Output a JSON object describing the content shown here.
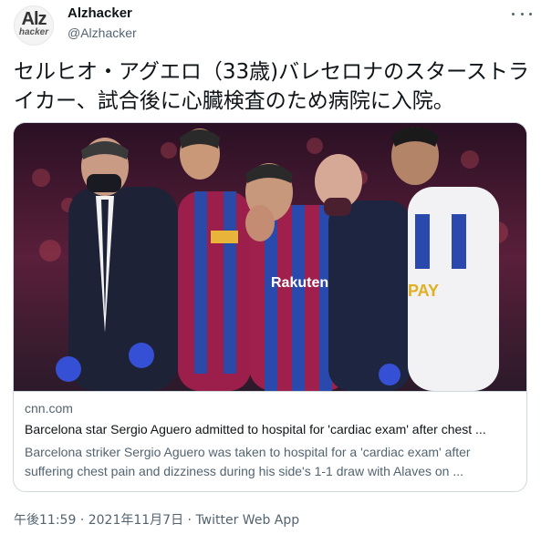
{
  "account": {
    "display_name": "Alzhacker",
    "handle": "@Alzhacker",
    "avatar_text_top": "Alz",
    "avatar_text_bottom": "hacker"
  },
  "tweet": {
    "text": "セルヒオ・アグエロ（33歳)バレセロナのスターストライカー、試合後に心臓検査のため病院に入院。"
  },
  "card": {
    "domain": "cnn.com",
    "title": "Barcelona star Sergio Aguero admitted to hospital for 'cardiac exam' after chest ...",
    "description": "Barcelona striker Sergio Aguero was taken to hospital for a 'cardiac exam' after suffering chest pain and dizziness during his side's 1-1 draw with Alaves on ...",
    "image_labels": {
      "shirt_sponsor": "Rakuten",
      "opponent_sponsor": "PAY"
    }
  },
  "footer": {
    "time": "午後11:59",
    "separator": "·",
    "date": "2021年11月7日",
    "source": "Twitter Web App"
  },
  "colors": {
    "text_primary": "#0f1419",
    "text_secondary": "#536471",
    "border": "#cfd9de"
  }
}
